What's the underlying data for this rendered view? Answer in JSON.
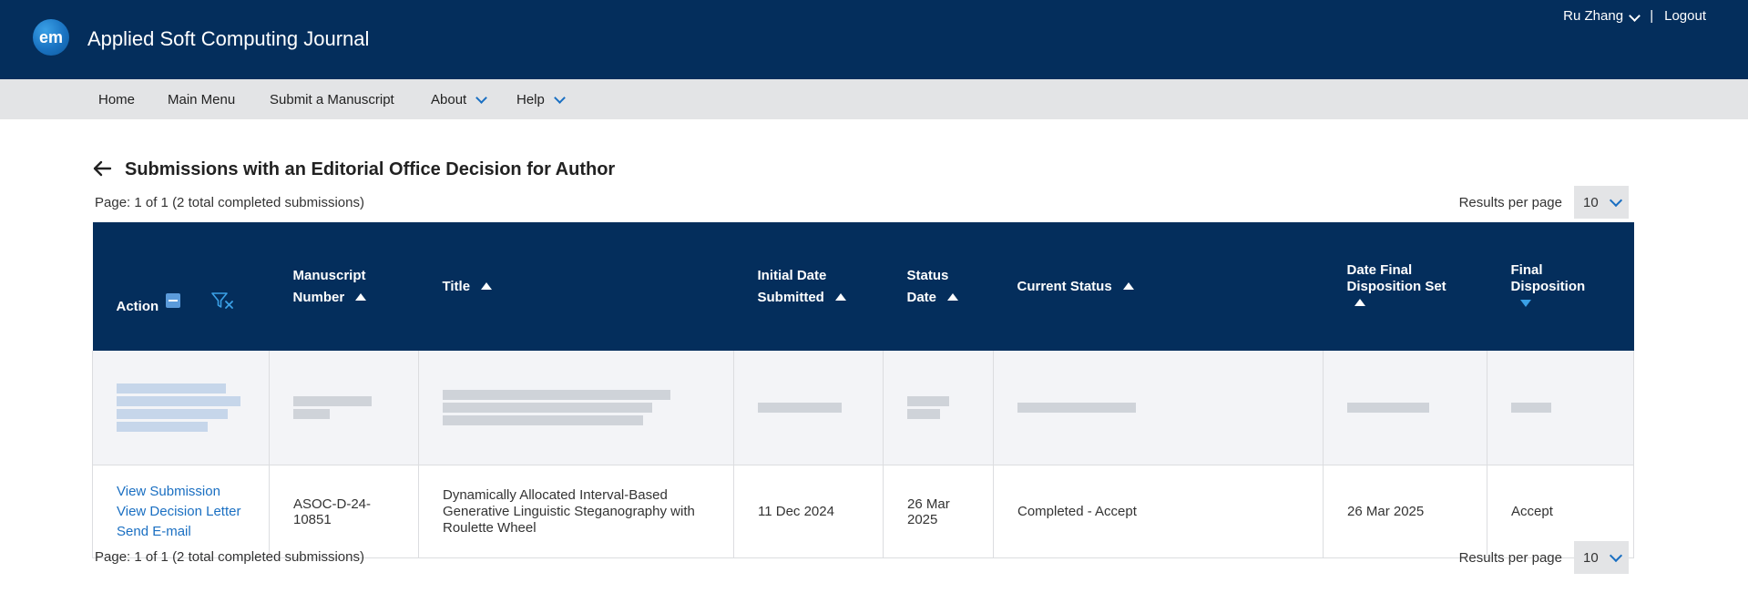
{
  "header": {
    "logo_text": "em",
    "journal_title": "Applied Soft Computing Journal",
    "user_name": "Ru Zhang",
    "separator": "|",
    "logout_label": "Logout"
  },
  "nav": {
    "items": [
      {
        "label": "Home",
        "has_dropdown": false
      },
      {
        "label": "Main Menu",
        "has_dropdown": false
      },
      {
        "label": "Submit a Manuscript",
        "has_dropdown": false
      },
      {
        "label": "About",
        "has_dropdown": true
      },
      {
        "label": "Help",
        "has_dropdown": true
      }
    ]
  },
  "page": {
    "title": "Submissions with an Editorial Office Decision for Author",
    "page_info_top": "Page: 1 of 1 (2 total completed submissions)",
    "page_info_bottom": "Page: 1 of 1 (2 total completed submissions)",
    "results_per_page_label": "Results per page",
    "results_per_page_value": "10"
  },
  "table": {
    "columns": [
      {
        "label": "Action"
      },
      {
        "label_line1": "Manuscript",
        "label_line2": "Number"
      },
      {
        "label": "Title"
      },
      {
        "label_line1": "Initial Date",
        "label_line2": "Submitted"
      },
      {
        "label_line1": "Status",
        "label_line2": "Date"
      },
      {
        "label": "Current Status"
      },
      {
        "label_line1": "Date Final",
        "label_line2": "Disposition Set"
      },
      {
        "label_line1": "Final",
        "label_line2": "Disposition"
      }
    ],
    "rows": [
      {
        "redacted": true
      },
      {
        "actions": [
          "View Submission",
          "View Decision Letter",
          "Send E-mail"
        ],
        "manuscript_number_line1": "ASOC-D-24-",
        "manuscript_number_line2": "10851",
        "title": "Dynamically Allocated Interval-Based Generative Linguistic Steganography with Roulette Wheel",
        "initial_date_submitted": "11 Dec 2024",
        "status_date_line1": "26 Mar",
        "status_date_line2": "2025",
        "current_status": "Completed - Accept",
        "date_final_disposition_set": "26 Mar 2025",
        "final_disposition": "Accept"
      }
    ]
  },
  "colors": {
    "header_bg": "#042e5c",
    "nav_bg": "#e3e4e6",
    "link": "#1a6fc2",
    "sort_active": "#3aa0e6"
  }
}
